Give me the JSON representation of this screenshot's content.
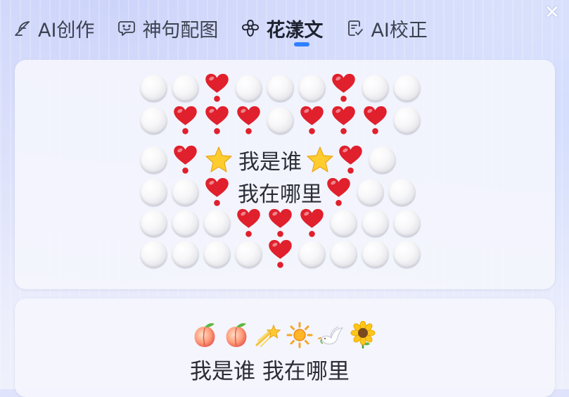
{
  "window": {
    "close_label": "✕"
  },
  "tabs": [
    {
      "label": "AI创作",
      "icon": "quill-icon",
      "active": false
    },
    {
      "label": "神句配图",
      "icon": "chat-smile-icon",
      "active": false
    },
    {
      "label": "花漾文",
      "icon": "flower-icon",
      "active": true
    },
    {
      "label": "AI校正",
      "icon": "doc-check-icon",
      "active": false
    }
  ],
  "colors": {
    "accent": "#2f80ff",
    "heart": "#e0202c",
    "star": "#ffcc2e",
    "text": "#2b2e36"
  },
  "cards": [
    {
      "rows": [
        {
          "items": [
            "dot",
            "dot",
            "heart",
            "dot",
            "dot",
            "dot",
            "heart",
            "dot",
            "dot"
          ]
        },
        {
          "items": [
            "dot",
            "heart",
            "heart",
            "heart",
            "dot",
            "heart",
            "heart",
            "heart",
            "dot"
          ]
        },
        {
          "items": [
            "dot",
            "heart",
            "star",
            "text:0",
            "star",
            "heart",
            "dot"
          ]
        },
        {
          "items": [
            "dot",
            "dot",
            "heart",
            "text:1",
            "heart",
            "dot",
            "dot"
          ]
        },
        {
          "items": [
            "dot",
            "dot",
            "dot",
            "heart",
            "heart",
            "heart",
            "dot",
            "dot",
            "dot"
          ]
        },
        {
          "items": [
            "dot",
            "dot",
            "dot",
            "dot",
            "heart",
            "dot",
            "dot",
            "dot",
            "dot"
          ]
        }
      ],
      "texts": [
        "我是谁",
        "我在哪里"
      ]
    },
    {
      "emojis": [
        "peach-icon",
        "peach-icon",
        "shooting-star-icon",
        "sun-icon",
        "dove-icon",
        "sunflower-icon"
      ],
      "text": "我是谁 我在哪里"
    }
  ]
}
